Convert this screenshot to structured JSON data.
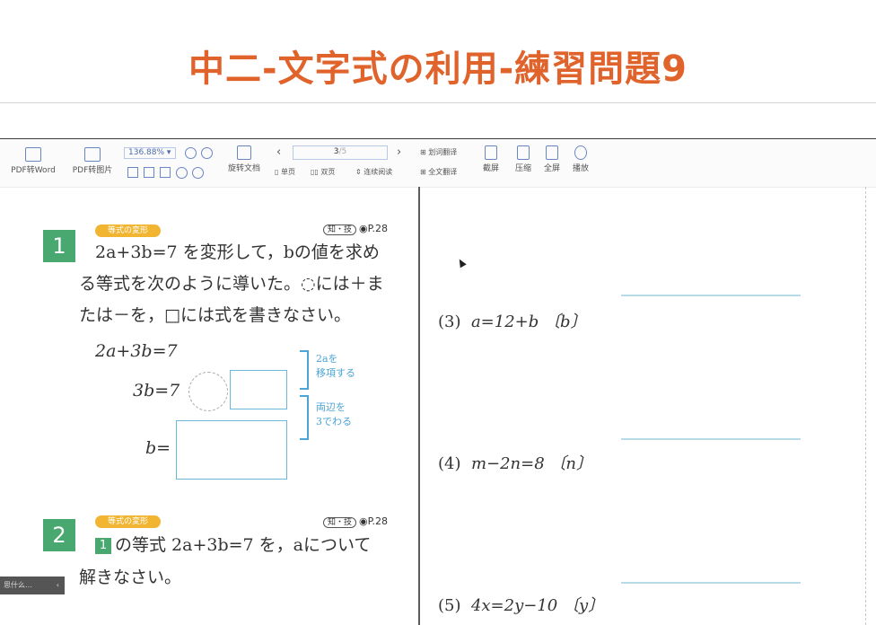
{
  "page_title": "中二-文字式の利用-練習問題9",
  "toolbar": {
    "pdf_to_word": "PDF转Word",
    "pdf_to_image": "PDF转图片",
    "zoom": "136.88%",
    "rotate_doc": "旋转文档",
    "single_page": "单页",
    "double_page": "双页",
    "continuous": "连续阅读",
    "page_current": "3",
    "page_total": "/5",
    "word_translate": "划词翻译",
    "full_translate": "全文翻译",
    "screenshot": "截屏",
    "compress": "压缩",
    "fullscreen": "全屏",
    "play": "播放"
  },
  "problem1": {
    "number": "1",
    "tag": "等式の変形",
    "ref_badge": "知・技",
    "ref_page": "P.28",
    "line1": "2a+3b=7 を変形して，bの値を求め",
    "line2": "る等式を次のように導いた。◌には＋ま",
    "line3": "たは－を，□には式を書きなさい。",
    "eq1": "2a+3b=7",
    "eq2": "3b=7",
    "eq3": "b=",
    "note1_a": "2aを",
    "note1_b": "移項する",
    "note2_a": "両辺を",
    "note2_b": "3でわる"
  },
  "problem2": {
    "number": "2",
    "tag": "等式の変形",
    "ref_badge": "知・技",
    "ref_page": "P.28",
    "badge": "1",
    "line1": "の等式 2a+3b=7 を，aについて",
    "line2": "解きなさい。"
  },
  "right_questions": [
    {
      "label": "(3)",
      "text": "a=12+b 〔b〕"
    },
    {
      "label": "(4)",
      "text": "m−2n=8 〔n〕"
    },
    {
      "label": "(5)",
      "text": "4x=2y−10 〔y〕"
    }
  ],
  "corner_button": "思什么…",
  "colors": {
    "title": "#e0632c",
    "badge_green": "#48a870",
    "tag_orange": "#f1b532",
    "answer_box": "#6bb8d6"
  }
}
